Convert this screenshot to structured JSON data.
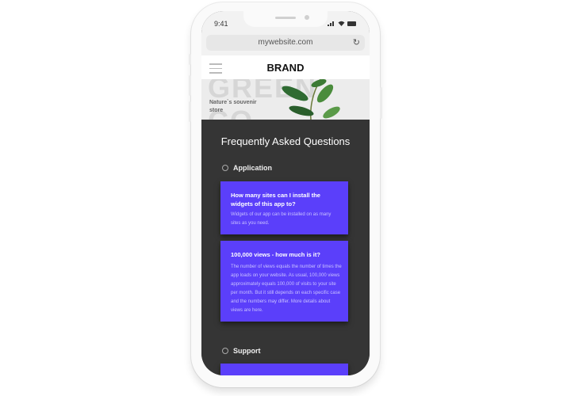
{
  "status_bar": {
    "time": "9:41",
    "signal_icon": "signal-icon",
    "wifi_icon": "wifi-icon",
    "battery_icon": "battery-icon"
  },
  "browser": {
    "url": "mywebsite.com",
    "reload_icon": "reload-icon"
  },
  "navbar": {
    "menu_icon": "hamburger-icon",
    "brand": "BRAND"
  },
  "hero": {
    "big_text": "GREEN CO",
    "subtitle": "Nature`s souvenir store"
  },
  "faq": {
    "title": "Frequently Asked Questions",
    "categories": [
      {
        "name": "Application",
        "icon": "gear-icon",
        "items": [
          {
            "question": "How many sites can I install the widgets of this app to?",
            "answer": "Widgets of our app can be installed on as many sites as you need."
          },
          {
            "question": "100,000 views - how much is it?",
            "answer": "The number of views equals the number of times the app loads on your website. As usual, 100,000 views approximately equals 100,000 of visits to your site per month. But it still depends on  each specific case and the numbers may differ. More details about views are here."
          }
        ]
      },
      {
        "name": "Support",
        "icon": "support-icon",
        "items": []
      }
    ]
  },
  "colors": {
    "accent": "#5b3ffa",
    "faq_background": "#353535"
  }
}
